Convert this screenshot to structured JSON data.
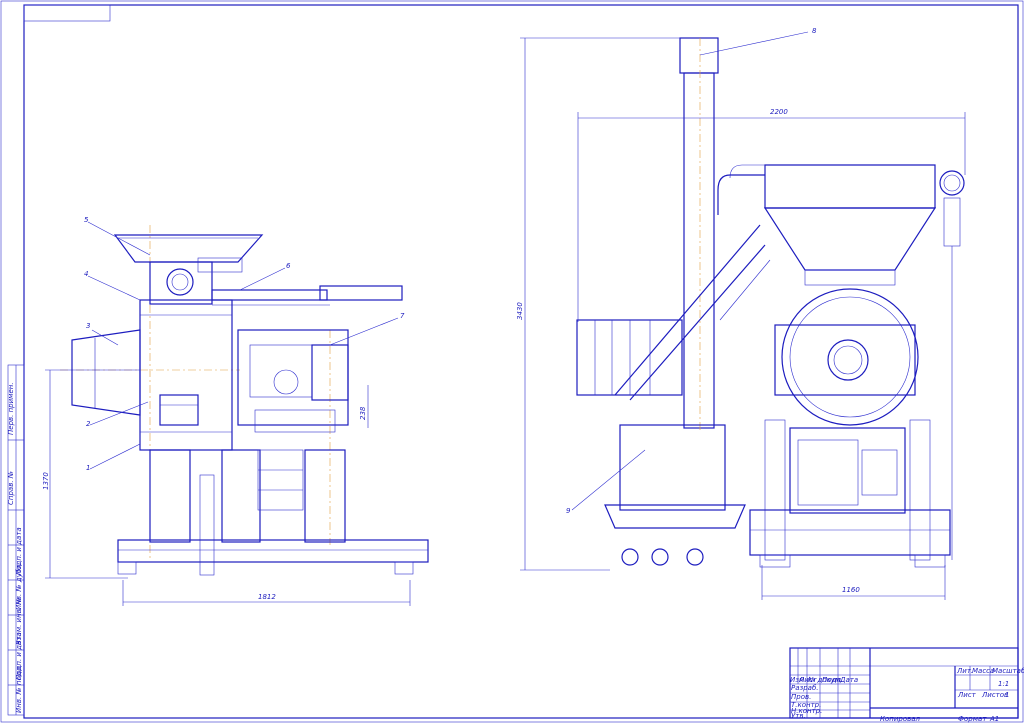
{
  "drawing": {
    "left_view": {
      "callouts": [
        "1",
        "2",
        "3",
        "4",
        "5",
        "6",
        "7"
      ],
      "dimensions": {
        "height": "1370",
        "width": "1812",
        "inner": "238"
      }
    },
    "right_view": {
      "callouts": [
        "8",
        "9"
      ],
      "dimensions": {
        "height": "3430",
        "top_width": "2200",
        "bottom_width": "1160"
      }
    },
    "side_strip": {
      "labels": [
        "Перв. примен.",
        "Справ. №",
        "Подп. и дата",
        "Инв. № дубл.",
        "Взам. инв. №",
        "Подп. и дата",
        "Инв. № подл."
      ]
    },
    "title_block": {
      "header_cells": [
        "Изм",
        "Лист",
        "№ докум.",
        "Подп.",
        "Дата"
      ],
      "role_labels": [
        "Разраб.",
        "Пров.",
        "Т.контр.",
        "Н.контр.",
        "Утв."
      ],
      "right_headers": [
        "Лит.",
        "Масса",
        "Масштаб"
      ],
      "scale_value": "1:1",
      "sheet_label": "Лист",
      "sheets_label": "Листов",
      "sheets_count": "1",
      "copied_label": "Копировал",
      "format_label": "Формат",
      "format_value": "А1"
    }
  }
}
